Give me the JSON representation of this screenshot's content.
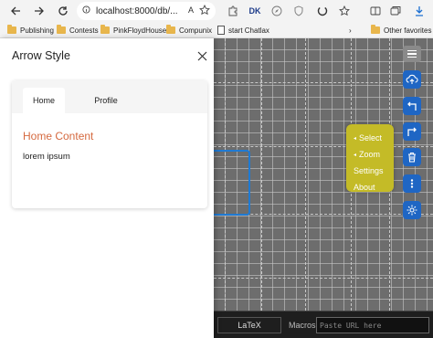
{
  "browser": {
    "url": "localhost:8000/db/...",
    "reader_label": "A",
    "extension_label": "DK",
    "bookmarks": [
      {
        "label": "Publishing"
      },
      {
        "label": "Contests"
      },
      {
        "label": "PinkFloydHouse"
      },
      {
        "label": "Compunix"
      },
      {
        "label": "start Chatlax"
      }
    ],
    "other_favorites": "Other favorites",
    "overflow_glyph": "›"
  },
  "panel": {
    "title": "Arrow Style",
    "tabs": [
      {
        "label": "Home",
        "active": true
      },
      {
        "label": "Profile",
        "active": false
      }
    ],
    "content_title": "Home Content",
    "content_body": "lorem ipsum"
  },
  "canvas": {
    "context_menu": [
      {
        "label": "Select",
        "has_bullet": true
      },
      {
        "label": "Zoom",
        "has_bullet": true
      },
      {
        "label": "Settings",
        "has_bullet": false
      },
      {
        "label": "About",
        "has_bullet": false
      }
    ],
    "tools": [
      {
        "icon": "cloud-upload-icon"
      },
      {
        "icon": "undo-arrow-icon"
      },
      {
        "icon": "redo-arrow-icon"
      },
      {
        "icon": "trash-icon"
      },
      {
        "icon": "more-vertical-icon"
      },
      {
        "icon": "gear-icon"
      }
    ],
    "bottom_bar": {
      "latex_label": "LaTeX",
      "macros_label": "Macros:",
      "url_placeholder": "Paste URL here"
    }
  },
  "colors": {
    "accent_orange": "#d5693f",
    "tool_blue": "#1f66c4",
    "menu_yellow": "#c4bb27",
    "canvas_gray": "#6d6d6d"
  }
}
